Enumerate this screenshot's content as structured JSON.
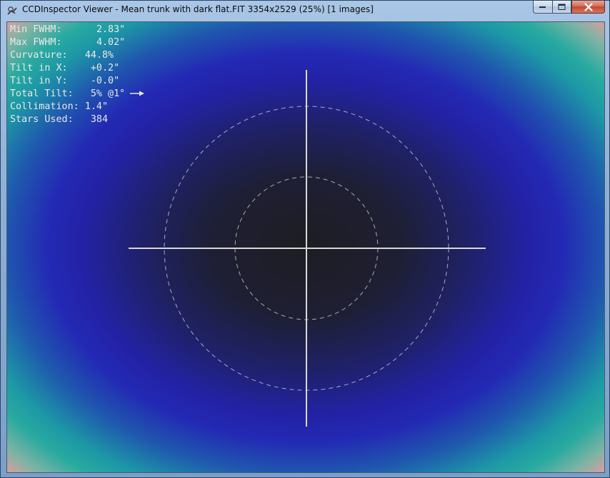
{
  "window": {
    "title": "CCDInspector Viewer - Mean trunk with dark flat.FIT 3354x2529 (25%)  [1 images]",
    "icons": {
      "app": "ccdinspector-app-icon",
      "minimize": "minimize-icon",
      "maximize": "maximize-icon",
      "close": "close-icon"
    }
  },
  "stats": [
    {
      "label": "Min FWHM:",
      "value": "2.83\""
    },
    {
      "label": "Max FWHM:",
      "value": "4.02\""
    },
    {
      "label": "Curvature:",
      "value": "44.8%"
    },
    {
      "label": "Tilt in X:",
      "value": "+0.2\""
    },
    {
      "label": "Tilt in Y:",
      "value": "-0.0\""
    },
    {
      "label": "Total Tilt:",
      "value": "5% @1°"
    },
    {
      "label": "Collimation:",
      "value": "1.4\""
    },
    {
      "label": "Stars Used:",
      "value": "384"
    }
  ],
  "tilt_indicator": {
    "icon": "tilt-direction-arrow-icon",
    "angle_deg": 1
  },
  "colors": {
    "overlay_lines": "#d8d8d8",
    "text": "#e8e8e8",
    "center": "#1d1d22",
    "mid": "#2322a6",
    "edge": "#28aaa0",
    "corner": "#f29a9a"
  }
}
